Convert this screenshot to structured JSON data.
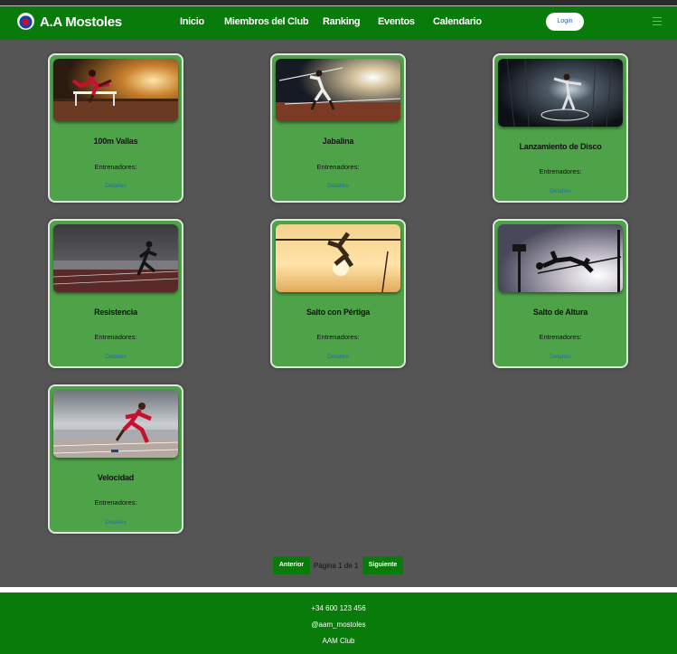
{
  "navbar": {
    "brand": "A.A Mostoles",
    "links": [
      "Inicio",
      "Miembros del Club",
      "Ranking",
      "Eventos",
      "Calendario"
    ],
    "login_label": "Login"
  },
  "cards": [
    {
      "title": "100m Vallas",
      "coaches_label": "Entrenadores:",
      "link_label": "Detalles"
    },
    {
      "title": "Jabalina",
      "coaches_label": "Entrenadores:",
      "link_label": "Detalles"
    },
    {
      "title": "Lanzamiento de Disco",
      "coaches_label": "Entrenadores:",
      "link_label": "Detalles"
    },
    {
      "title": "Resistencia",
      "coaches_label": "Entrenadores:",
      "link_label": "Detalles"
    },
    {
      "title": "Salto con Pértiga",
      "coaches_label": "Entrenadores:",
      "link_label": "Detalles"
    },
    {
      "title": "Salto de Altura",
      "coaches_label": "Entrenadores:",
      "link_label": "Detalles"
    },
    {
      "title": "Velocidad",
      "coaches_label": "Entrenadores:",
      "link_label": "Detalles"
    }
  ],
  "pagination": {
    "prev_label": "Anterior",
    "page_text": "Página 1 de 1",
    "next_label": "Siguiente"
  },
  "footer": {
    "phone": "+34 600 123 456",
    "social": "@aam_mostoles",
    "club": "AAM Club"
  },
  "colors": {
    "brand_green": "#087b0a",
    "card_green": "#4ea349",
    "background": "#555555",
    "link_blue": "#1f6ac8"
  }
}
